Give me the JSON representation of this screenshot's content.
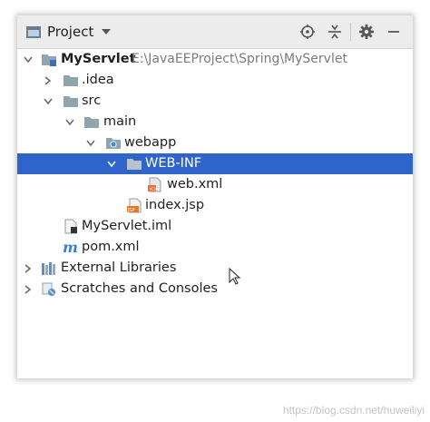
{
  "panel": {
    "title": "Project",
    "tools": [
      "locate-icon",
      "collapse-icon",
      "gear-icon",
      "minimize-icon"
    ]
  },
  "tree": {
    "root": {
      "label": "MyServlet",
      "path": "E:\\JavaEEProject\\Spring\\MyServlet"
    },
    "idea": {
      "label": ".idea"
    },
    "src": {
      "label": "src"
    },
    "main": {
      "label": "main"
    },
    "webapp": {
      "label": "webapp"
    },
    "webinf": {
      "label": "WEB-INF"
    },
    "webxml": {
      "label": "web.xml"
    },
    "indexjsp": {
      "label": "index.jsp"
    },
    "iml": {
      "label": "MyServlet.iml"
    },
    "pom": {
      "label": "pom.xml"
    },
    "extlibs": {
      "label": "External Libraries"
    },
    "scratches": {
      "label": "Scratches and Consoles"
    }
  },
  "watermark": "https://blog.csdn.net/huweiliyi",
  "colors": {
    "selection": "#2f65ca",
    "header": "#ececec",
    "folder": "#90a4ae"
  }
}
